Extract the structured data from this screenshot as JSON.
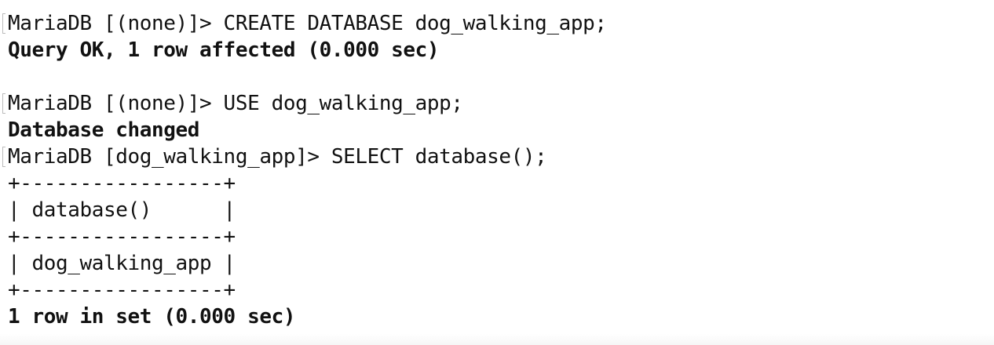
{
  "terminal": {
    "lines": [
      {
        "text": "MariaDB [(none)]> CREATE DATABASE dog_walking_app;",
        "kind": "prompt"
      },
      {
        "text": "Query OK, 1 row affected (0.000 sec)",
        "kind": "output"
      },
      {
        "text": "",
        "kind": "blank"
      },
      {
        "text": "MariaDB [(none)]> USE dog_walking_app;",
        "kind": "prompt"
      },
      {
        "text": "Database changed",
        "kind": "output"
      },
      {
        "text": "MariaDB [dog_walking_app]> SELECT database();",
        "kind": "prompt"
      },
      {
        "text": "+-----------------+",
        "kind": "table"
      },
      {
        "text": "| database()      |",
        "kind": "table"
      },
      {
        "text": "+-----------------+",
        "kind": "table"
      },
      {
        "text": "| dog_walking_app |",
        "kind": "table"
      },
      {
        "text": "+-----------------+",
        "kind": "table"
      },
      {
        "text": "1 row in set (0.000 sec)",
        "kind": "output"
      }
    ]
  }
}
